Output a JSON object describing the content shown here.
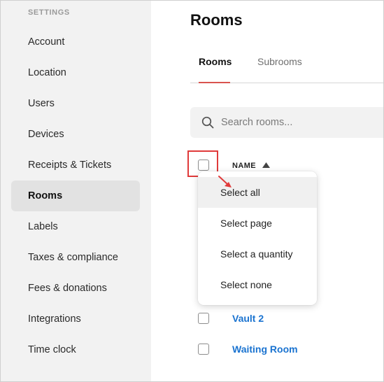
{
  "sidebar": {
    "heading": "SETTINGS",
    "items": [
      {
        "label": "Account"
      },
      {
        "label": "Location"
      },
      {
        "label": "Users"
      },
      {
        "label": "Devices"
      },
      {
        "label": "Receipts & Tickets"
      },
      {
        "label": "Rooms",
        "active": true
      },
      {
        "label": "Labels"
      },
      {
        "label": "Taxes & compliance"
      },
      {
        "label": "Fees & donations"
      },
      {
        "label": "Integrations"
      },
      {
        "label": "Time clock"
      }
    ]
  },
  "main": {
    "title": "Rooms",
    "tabs": [
      {
        "label": "Rooms",
        "active": true
      },
      {
        "label": "Subrooms"
      }
    ],
    "search": {
      "placeholder": "Search rooms..."
    },
    "table": {
      "column_name": "NAME",
      "sort": "ascending",
      "rows": [
        {
          "name": "Vault 2"
        },
        {
          "name": "Waiting Room"
        }
      ]
    },
    "select_menu": {
      "items": [
        {
          "label": "Select all",
          "hovered": true
        },
        {
          "label": "Select page"
        },
        {
          "label": "Select a quantity"
        },
        {
          "label": "Select none"
        }
      ]
    }
  },
  "colors": {
    "accent_red": "#e03a3a",
    "link_blue": "#1a73d0",
    "sidebar_bg": "#f2f2f2"
  },
  "icons": {
    "search": "search-icon",
    "sort": "sort-ascending-icon",
    "arrow": "annotation-arrow-icon"
  }
}
